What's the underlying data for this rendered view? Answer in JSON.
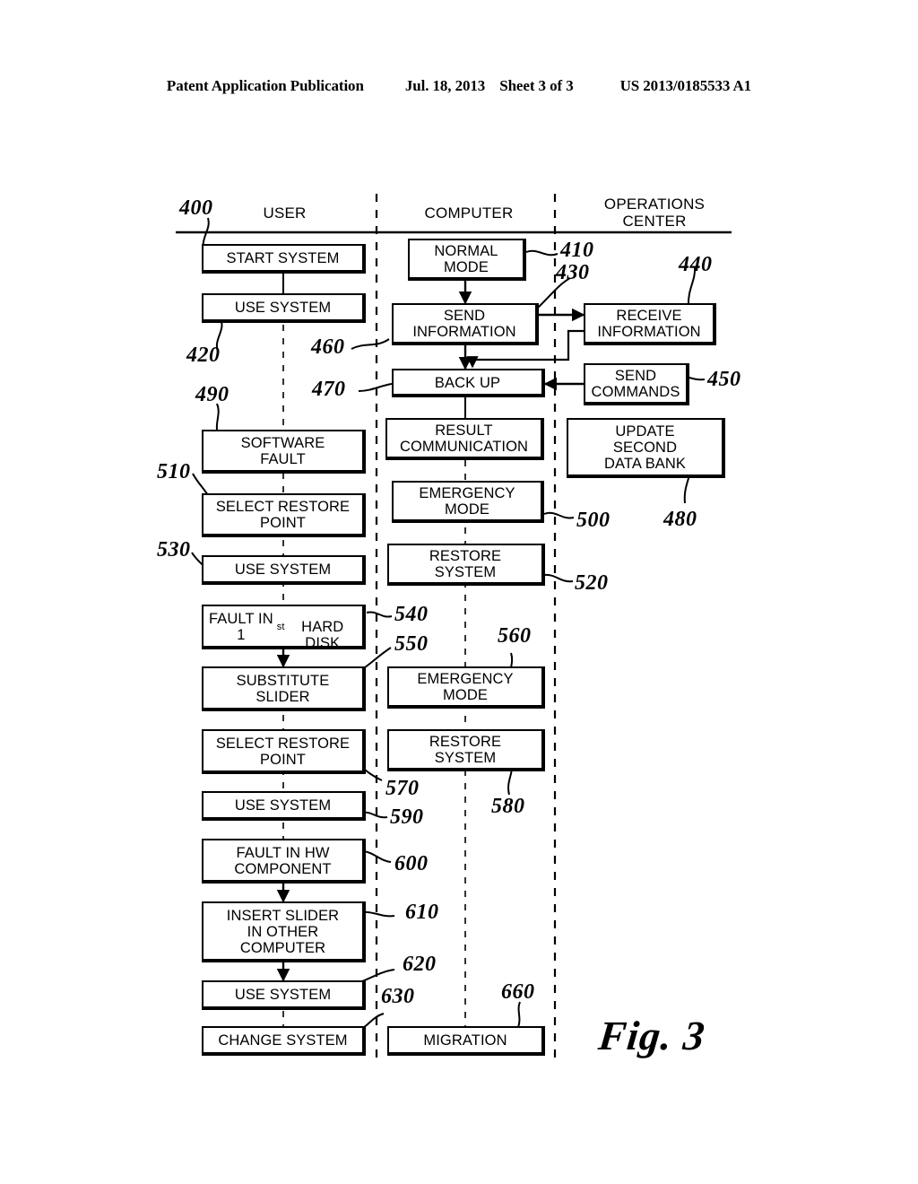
{
  "page_header": {
    "publication": "Patent Application Publication",
    "date": "Jul. 18, 2013",
    "sheet": "Sheet 3 of 3",
    "patent_number": "US 2013/0185533 A1"
  },
  "figure": {
    "caption": "Fig. 3",
    "lanes": [
      {
        "id": "user",
        "label": "USER"
      },
      {
        "id": "computer",
        "label": "COMPUTER"
      },
      {
        "id": "operations",
        "label": "OPERATIONS\nCENTER"
      }
    ],
    "boxes": [
      {
        "id": "start-system",
        "lane": "user",
        "label": "START SYSTEM"
      },
      {
        "id": "use-system-1",
        "lane": "user",
        "label": "USE SYSTEM"
      },
      {
        "id": "software-fault",
        "lane": "user",
        "label": "SOFTWARE\nFAULT"
      },
      {
        "id": "select-restore-point-1",
        "lane": "user",
        "label": "SELECT RESTORE\nPOINT"
      },
      {
        "id": "use-system-2",
        "lane": "user",
        "label": "USE SYSTEM"
      },
      {
        "id": "fault-first-hard-disk",
        "lane": "user",
        "label": "FAULT IN 1st\nHARD DISK"
      },
      {
        "id": "substitute-slider",
        "lane": "user",
        "label": "SUBSTITUTE\nSLIDER"
      },
      {
        "id": "select-restore-point-2",
        "lane": "user",
        "label": "SELECT RESTORE\nPOINT"
      },
      {
        "id": "use-system-3",
        "lane": "user",
        "label": "USE SYSTEM"
      },
      {
        "id": "fault-hw-component",
        "lane": "user",
        "label": "FAULT IN HW\nCOMPONENT"
      },
      {
        "id": "insert-slider",
        "lane": "user",
        "label": "INSERT SLIDER\nIN OTHER\nCOMPUTER"
      },
      {
        "id": "use-system-4",
        "lane": "user",
        "label": "USE SYSTEM"
      },
      {
        "id": "change-system",
        "lane": "user",
        "label": "CHANGE SYSTEM"
      },
      {
        "id": "normal-mode",
        "lane": "computer",
        "label": "NORMAL\nMODE"
      },
      {
        "id": "send-information",
        "lane": "computer",
        "label": "SEND\nINFORMATION"
      },
      {
        "id": "back-up",
        "lane": "computer",
        "label": "BACK UP"
      },
      {
        "id": "result-communication",
        "lane": "computer",
        "label": "RESULT\nCOMMUNICATION"
      },
      {
        "id": "emergency-mode-1",
        "lane": "computer",
        "label": "EMERGENCY\nMODE"
      },
      {
        "id": "restore-system-1",
        "lane": "computer",
        "label": "RESTORE\nSYSTEM"
      },
      {
        "id": "emergency-mode-2",
        "lane": "computer",
        "label": "EMERGENCY\nMODE"
      },
      {
        "id": "restore-system-2",
        "lane": "computer",
        "label": "RESTORE\nSYSTEM"
      },
      {
        "id": "migration",
        "lane": "computer",
        "label": "MIGRATION"
      },
      {
        "id": "receive-information",
        "lane": "operations",
        "label": "RECEIVE\nINFORMATION"
      },
      {
        "id": "send-commands",
        "lane": "operations",
        "label": "SEND\nCOMMANDS"
      },
      {
        "id": "update-second-data-bank",
        "lane": "operations",
        "label": "UPDATE\nSECOND\nDATA BANK"
      }
    ],
    "reference_numerals": [
      {
        "id": "ref-400",
        "value": "400"
      },
      {
        "id": "ref-410",
        "value": "410"
      },
      {
        "id": "ref-420",
        "value": "420"
      },
      {
        "id": "ref-430",
        "value": "430"
      },
      {
        "id": "ref-440",
        "value": "440"
      },
      {
        "id": "ref-450",
        "value": "450"
      },
      {
        "id": "ref-460",
        "value": "460"
      },
      {
        "id": "ref-470",
        "value": "470"
      },
      {
        "id": "ref-480",
        "value": "480"
      },
      {
        "id": "ref-490",
        "value": "490"
      },
      {
        "id": "ref-500",
        "value": "500"
      },
      {
        "id": "ref-510",
        "value": "510"
      },
      {
        "id": "ref-520",
        "value": "520"
      },
      {
        "id": "ref-530",
        "value": "530"
      },
      {
        "id": "ref-540",
        "value": "540"
      },
      {
        "id": "ref-550",
        "value": "550"
      },
      {
        "id": "ref-560",
        "value": "560"
      },
      {
        "id": "ref-570",
        "value": "570"
      },
      {
        "id": "ref-580",
        "value": "580"
      },
      {
        "id": "ref-590",
        "value": "590"
      },
      {
        "id": "ref-600",
        "value": "600"
      },
      {
        "id": "ref-610",
        "value": "610"
      },
      {
        "id": "ref-620",
        "value": "620"
      },
      {
        "id": "ref-630",
        "value": "630"
      },
      {
        "id": "ref-660",
        "value": "660"
      }
    ]
  },
  "colors": {
    "ink": "#000000",
    "paper": "#ffffff"
  }
}
